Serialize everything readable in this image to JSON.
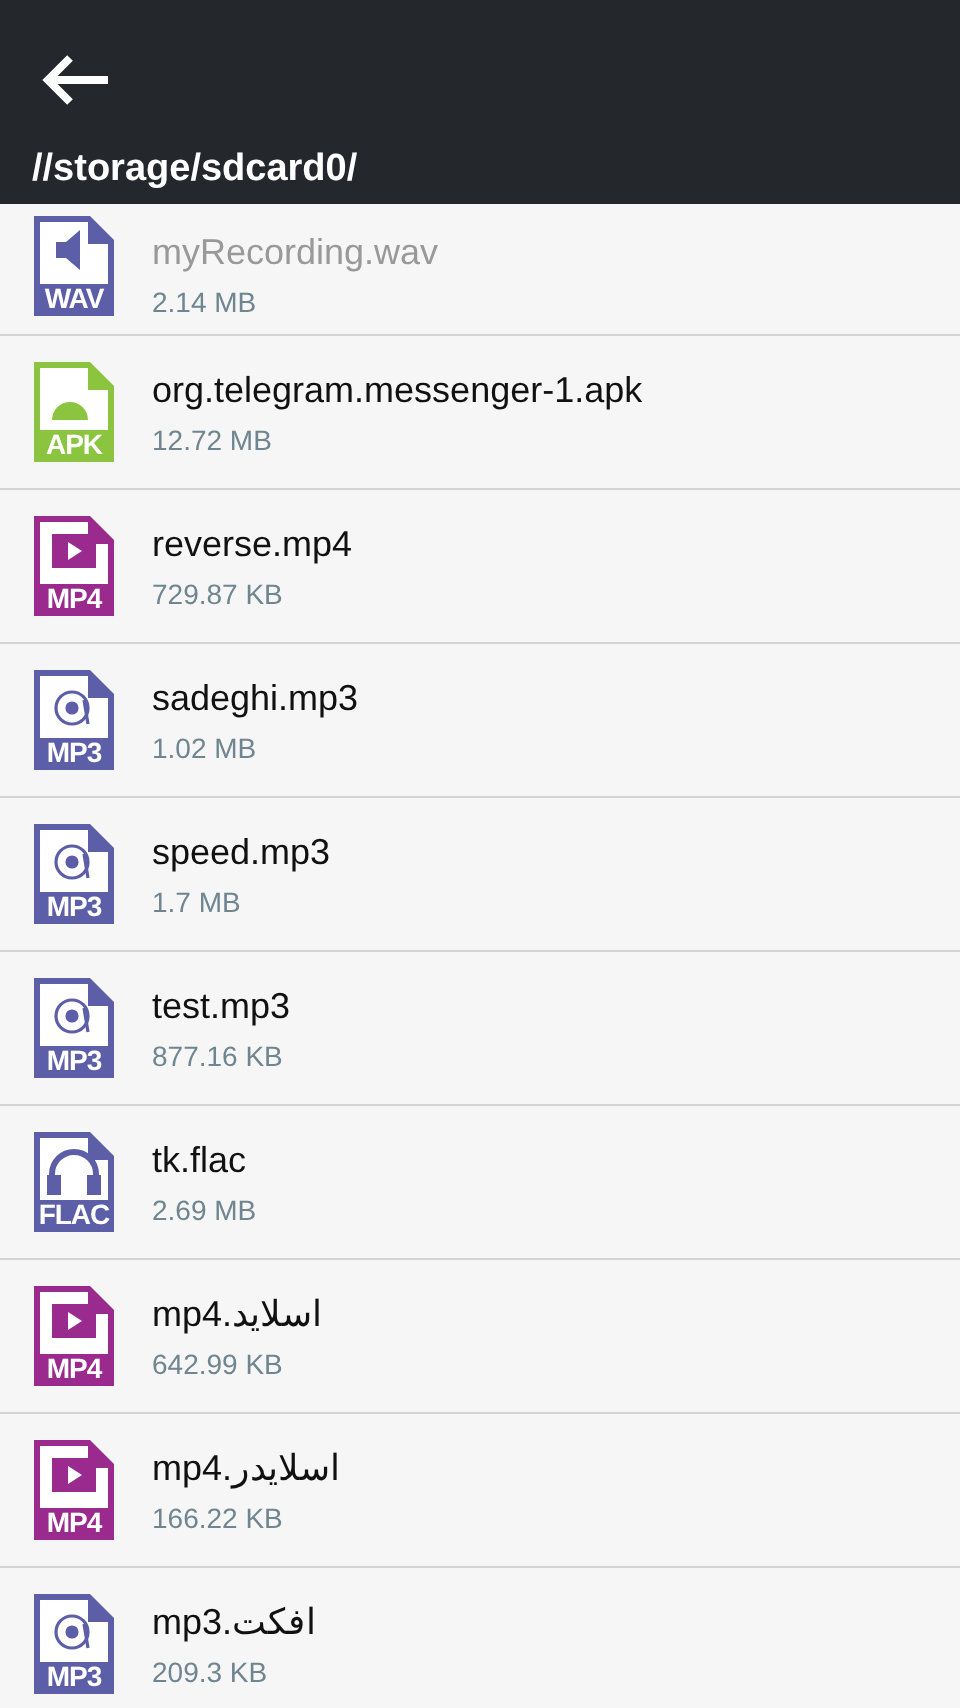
{
  "header": {
    "path": "//storage/sdcard0/"
  },
  "files": [
    {
      "name": "myRecording.wav",
      "size": "2.14 MB",
      "kind": "audio",
      "badge": "WAV",
      "color": "#5d5ea8"
    },
    {
      "name": "org.telegram.messenger-1.apk",
      "size": "12.72 MB",
      "kind": "app",
      "badge": "APK",
      "color": "#8bc53f"
    },
    {
      "name": "reverse.mp4",
      "size": "729.87 KB",
      "kind": "video",
      "badge": "MP4",
      "color": "#9a2a8e"
    },
    {
      "name": "sadeghi.mp3",
      "size": "1.02 MB",
      "kind": "music",
      "badge": "MP3",
      "color": "#5d5ea8"
    },
    {
      "name": "speed.mp3",
      "size": "1.7 MB",
      "kind": "music",
      "badge": "MP3",
      "color": "#5d5ea8"
    },
    {
      "name": "test.mp3",
      "size": "877.16 KB",
      "kind": "music",
      "badge": "MP3",
      "color": "#5d5ea8"
    },
    {
      "name": "tk.flac",
      "size": "2.69 MB",
      "kind": "headphones",
      "badge": "FLAC",
      "color": "#5d5ea8"
    },
    {
      "name": "اسلاید.mp4",
      "size": "642.99 KB",
      "kind": "video",
      "badge": "MP4",
      "color": "#9a2a8e"
    },
    {
      "name": "اسلایدر.mp4",
      "size": "166.22 KB",
      "kind": "video",
      "badge": "MP4",
      "color": "#9a2a8e"
    },
    {
      "name": "افکت.mp3",
      "size": "209.3 KB",
      "kind": "music",
      "badge": "MP3",
      "color": "#5d5ea8"
    }
  ]
}
